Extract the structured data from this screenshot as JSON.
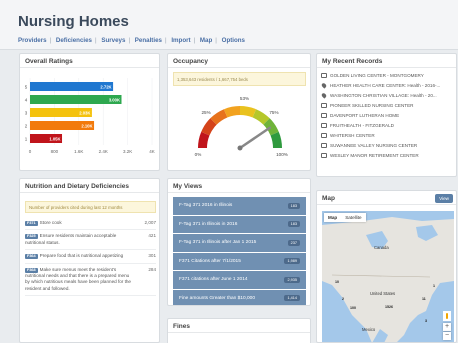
{
  "app": {
    "title": "Nursing Homes"
  },
  "nav": [
    "Providers",
    "Deficiencies",
    "Surveys",
    "Penalties",
    "Import",
    "Map",
    "Options"
  ],
  "ratings": {
    "title": "Overall Ratings",
    "chart_data": {
      "type": "bar",
      "orientation": "horizontal",
      "categories": [
        "5",
        "4",
        "3",
        "2",
        "1"
      ],
      "values": [
        2724,
        3000,
        2030,
        2100,
        1050
      ],
      "data_labels": [
        "2.72K",
        "3.00K",
        "2.03K",
        "2.10K",
        "1.05K"
      ],
      "colors": [
        "#1f77d0",
        "#2ea84f",
        "#f4c20d",
        "#f27a0c",
        "#c0141b"
      ],
      "xlim": [
        0,
        4000
      ],
      "xticks": [
        "0",
        "800",
        "1.6K",
        "2.4K",
        "3.2K",
        "4K"
      ]
    }
  },
  "occupancy": {
    "title": "Occupancy",
    "note": "1,353,643 residents / 1,667,754 beds",
    "chart_data": {
      "type": "gauge",
      "value": 81,
      "min_label": "0%",
      "max_label": "100%",
      "ticks": [
        "25%",
        "53%",
        "75%"
      ]
    }
  },
  "records": {
    "title": "My Recent Records",
    "items": [
      {
        "icon": "card-icon",
        "text": "GOLDEN LIVING CENTER - MONTGOMERY"
      },
      {
        "icon": "map-pin-icon",
        "text": "HEATHER HEALTH CARE CENTER: Health - 2016-..."
      },
      {
        "icon": "map-pin-icon",
        "text": "WASHINGTON CHRISTIAN VILLAGE: Health - 20..."
      },
      {
        "icon": "card-icon",
        "text": "PIONEER SKILLED NURSING CENTER"
      },
      {
        "icon": "card-icon",
        "text": "DAVENPORT LUTHERAN HOME"
      },
      {
        "icon": "card-icon",
        "text": "FRUITHEALTH - FITZGERALD"
      },
      {
        "icon": "card-icon",
        "text": "WHITERSH CENTER"
      },
      {
        "icon": "card-icon",
        "text": "SUWANNEE VALLEY NURSING CENTER"
      },
      {
        "icon": "card-icon",
        "text": "WESLEY MANOR RETIREMENT CENTER"
      }
    ]
  },
  "nutrition": {
    "title": "Nutrition and Dietary Deficiencies",
    "note": "Number of providers cited during last 12 months",
    "rows": [
      {
        "tag": "F371",
        "text": "Store cook",
        "count": "2,007"
      },
      {
        "tag": "F325",
        "text": "Ensure residents maintain acceptable nutritional status.",
        "count": "421"
      },
      {
        "tag": "F364",
        "text": "Prepare food that is nutritional appetizing",
        "count": "301"
      },
      {
        "tag": "F368",
        "text": "Make sure menus meet the resident's nutritional needs and that there is a prepared menu by which nutritious meals have been planned for the resident and followed.",
        "count": "284"
      }
    ]
  },
  "views": {
    "title": "My Views",
    "items": [
      {
        "label": "F-Tag 371 2016 in Illinois",
        "badge": "183"
      },
      {
        "label": "F-Tag 371 in Illinois in 2016",
        "badge": "183"
      },
      {
        "label": "F-Tag 371 in Illinois after Jan 1 2015",
        "badge": "237"
      },
      {
        "label": "F371 Citations after 7/1/2015",
        "badge": "1,989"
      },
      {
        "label": "F371 citations after June 1 2014",
        "badge": "2,935"
      },
      {
        "label": "Fine amounts Greater than $10,000",
        "badge": "1,414"
      }
    ]
  },
  "fines": {
    "title": "Fines"
  },
  "map": {
    "title": "Map",
    "view_label": "View",
    "tabs": [
      "Map",
      "Satellite"
    ],
    "labels": {
      "canada": "Canada",
      "us": "United States",
      "mexico": "Mexico"
    },
    "clusters": [
      "10",
      "2",
      "100",
      "1526",
      "11",
      "1",
      "3"
    ],
    "zoom_in": "+",
    "zoom_out": "−"
  }
}
